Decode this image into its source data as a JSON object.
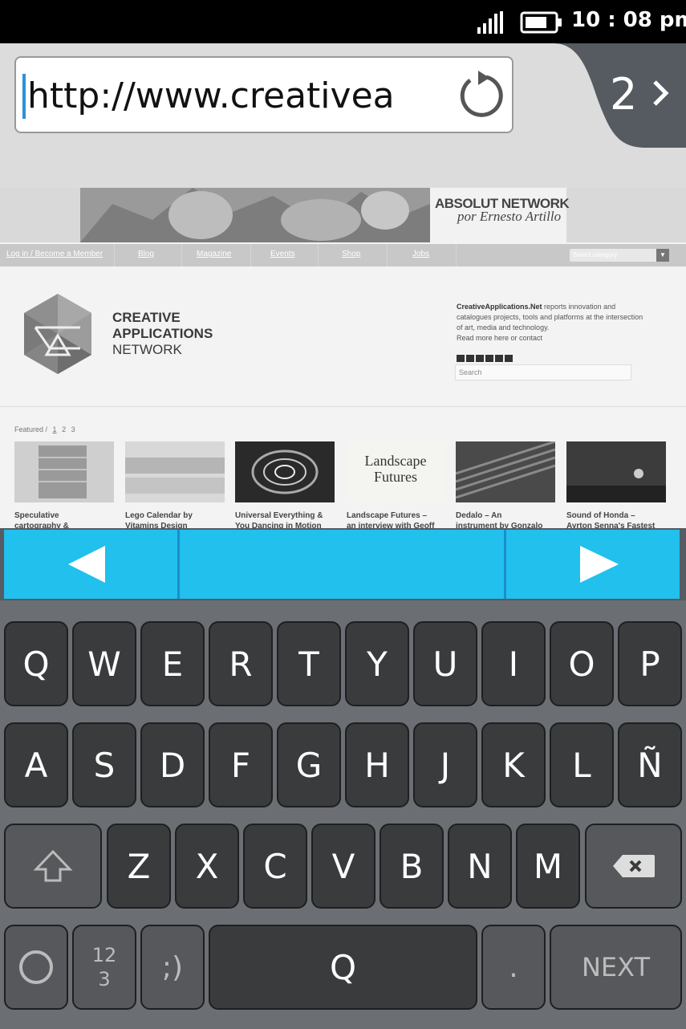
{
  "status_bar": {
    "time": "10 : 08 pm",
    "icons": [
      "signal-icon",
      "battery-icon"
    ]
  },
  "browser": {
    "url": "http://www.creativea",
    "tab_count": "2",
    "icons": [
      "reload-icon",
      "chevron-right-icon"
    ]
  },
  "webpage": {
    "banner": {
      "brand": "ABSOLUT NETWORK",
      "author": "por Ernesto Artillo"
    },
    "nav": {
      "items": [
        "Log in / Become a Member",
        "Blog",
        "Magazine",
        "Events",
        "Shop",
        "Jobs"
      ],
      "category_placeholder": "Select category"
    },
    "logo": {
      "line1": "CREATIVE",
      "line2": "APPLICATIONS",
      "line3": "NETWORK"
    },
    "about": {
      "brand": "CreativeApplications.Net",
      "line1_rest": " reports innovation and",
      "line2": "catalogues projects, tools and platforms at the intersection",
      "line3": "of art, media and technology.",
      "line4": "Read more here or contact",
      "search_placeholder": "Search"
    },
    "featured": {
      "label": "Featured /",
      "pages": [
        "1",
        "2",
        "3"
      ],
      "landscape_title": "Landscape Futures",
      "items": [
        {
          "title": "Speculative",
          "subtitle": "cartography &"
        },
        {
          "title": "Lego Calendar by",
          "subtitle": "Vitamins Design"
        },
        {
          "title": "Universal Everything &",
          "subtitle": "You Dancing in Motion"
        },
        {
          "title": "Landscape Futures –",
          "subtitle": "an interview with Geoff"
        },
        {
          "title": "Dedalo – An",
          "subtitle": "instrument by Gonzalo"
        },
        {
          "title": "Sound of Honda –",
          "subtitle": "Ayrton Senna's Fastest"
        }
      ]
    }
  },
  "selection_bar": {
    "icons": [
      "triangle-left-icon",
      "triangle-right-icon"
    ]
  },
  "keyboard": {
    "row1": [
      "Q",
      "W",
      "E",
      "R",
      "T",
      "Y",
      "U",
      "I",
      "O",
      "P"
    ],
    "row2": [
      "A",
      "S",
      "D",
      "F",
      "G",
      "H",
      "J",
      "K",
      "L",
      "Ñ"
    ],
    "row3": [
      "Z",
      "X",
      "C",
      "V",
      "B",
      "N",
      "M"
    ],
    "numbers_key": "12\n3",
    "emoji_key": ";)",
    "space_key": "Q",
    "dot_key": ".",
    "next_key": "NEXT",
    "icons": [
      "shift-icon",
      "backspace-icon",
      "circle-icon"
    ]
  }
}
